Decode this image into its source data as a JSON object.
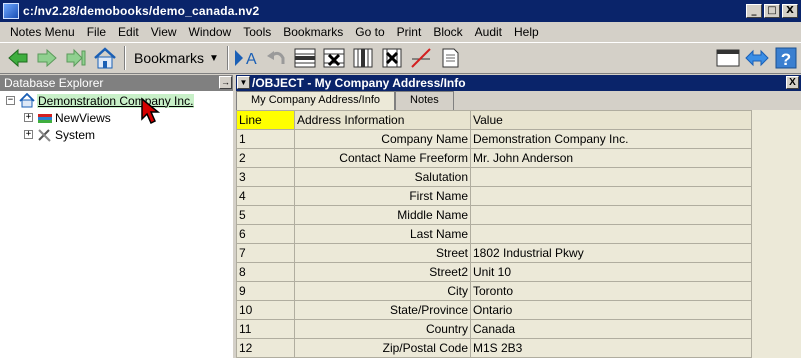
{
  "window": {
    "title": "c:/nv2.28/demobooks/demo_canada.nv2",
    "min": "_",
    "max": "□",
    "close": "X"
  },
  "menu": [
    "Notes Menu",
    "File",
    "Edit",
    "View",
    "Window",
    "Tools",
    "Bookmarks",
    "Go to",
    "Print",
    "Block",
    "Audit",
    "Help"
  ],
  "toolbar": {
    "bookmarks_label": "Bookmarks",
    "icons": [
      "back-arrow-icon",
      "forward-arrow-icon",
      "last-arrow-icon",
      "home-icon",
      "bookmarks-dropdown",
      "text-mode-icon",
      "undo-icon",
      "insert-row-icon",
      "delete-row-icon",
      "insert-column-icon",
      "delete-column-icon",
      "no-line-icon",
      "notes-icon",
      "window-icon",
      "swap-icon",
      "help-icon"
    ]
  },
  "explorer": {
    "header": "Database Explorer",
    "pin": "→",
    "tree": [
      {
        "label": "Demonstration Company Inc.",
        "expander": "−",
        "icon": "home-icon",
        "selected": true
      },
      {
        "label": "NewViews",
        "expander": "+",
        "icon": "books-icon"
      },
      {
        "label": "System",
        "expander": "+",
        "icon": "tools-icon"
      }
    ]
  },
  "document": {
    "dropdown": "▼",
    "title": "/OBJECT - My Company Address/Info",
    "close": "X",
    "tabs": [
      "My Company Address/Info",
      "Notes"
    ],
    "columns": [
      "Line",
      "Address Information",
      "Value"
    ],
    "rows": [
      {
        "line": "1",
        "info": "Company Name",
        "value": "Demonstration Company Inc."
      },
      {
        "line": "2",
        "info": "Contact Name Freeform",
        "value": "Mr. John Anderson"
      },
      {
        "line": "3",
        "info": "Salutation",
        "value": ""
      },
      {
        "line": "4",
        "info": "First Name",
        "value": ""
      },
      {
        "line": "5",
        "info": "Middle Name",
        "value": ""
      },
      {
        "line": "6",
        "info": "Last Name",
        "value": ""
      },
      {
        "line": "7",
        "info": "Street",
        "value": "1802 Industrial Pkwy"
      },
      {
        "line": "8",
        "info": "Street2",
        "value": "Unit 10"
      },
      {
        "line": "9",
        "info": "City",
        "value": "Toronto"
      },
      {
        "line": "10",
        "info": "State/Province",
        "value": "Ontario"
      },
      {
        "line": "11",
        "info": "Country",
        "value": "Canada"
      },
      {
        "line": "12",
        "info": "Zip/Postal Code",
        "value": "M1S 2B3"
      }
    ]
  },
  "colors": {
    "titlebar": "#0a246a",
    "line_header": "#ffff00",
    "selected_tree": "#c8f0c8",
    "grid_bg": "#ece9d8"
  }
}
